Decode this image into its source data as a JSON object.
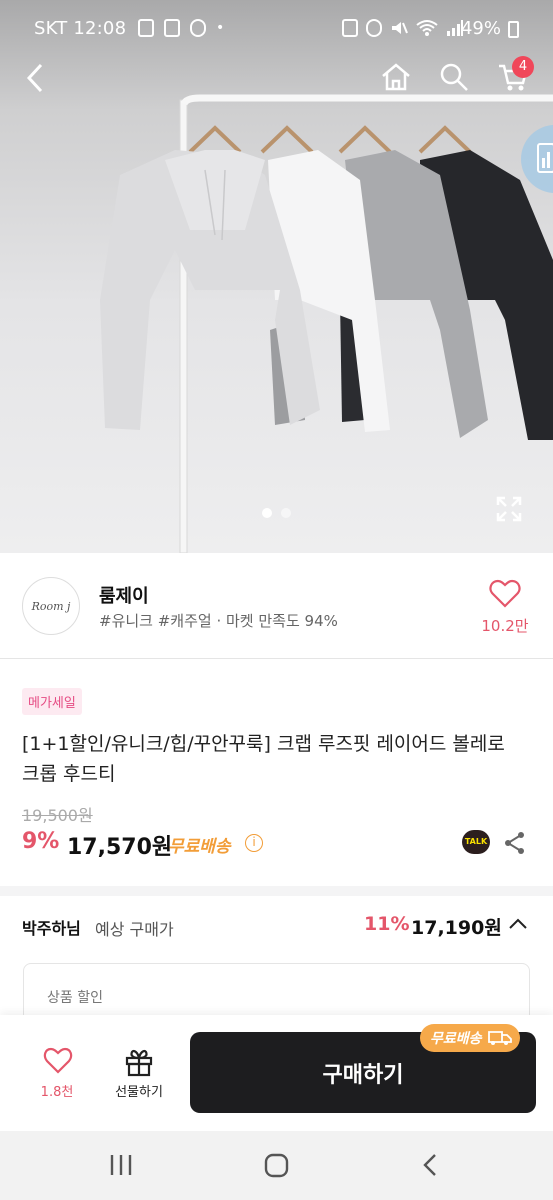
{
  "status_bar": {
    "carrier_time": "SKT 12:08",
    "battery": "49%",
    "dot": "•"
  },
  "top_bar": {
    "cart_count": "4"
  },
  "gallery": {
    "total_images": 2,
    "current_index": 1
  },
  "store": {
    "logo_text": "Room j",
    "name": "룸제이",
    "tags": "#유니크 #캐주얼 · 마켓 만족도 94%",
    "like_count": "10.2만"
  },
  "product": {
    "badge": "메가세일",
    "title": "[1+1할인/유니크/힙/꾸안꾸룩] 크랩 루즈핏 레이어드 볼레로 크롭 후드티",
    "original_price": "19,500원",
    "discount": "9%",
    "price": "17,570원",
    "free_shipping": "무료배송",
    "info_glyph": "i",
    "kakao_label": "TALK"
  },
  "expected_price": {
    "buyer": "박주하님",
    "label": "예상 구매가",
    "discount": "11%",
    "price": "17,190원"
  },
  "discount_box": {
    "label": "상품 할인"
  },
  "bottom_bar": {
    "like_count": "1.8천",
    "gift_label": "선물하기",
    "buy_label": "구매하기",
    "shipping_pill": "무료배송"
  },
  "colors": {
    "accent_pink": "#e4566a",
    "orange": "#f29d38",
    "buy_button": "#1d1d1f",
    "badge_pink": "#e64c84"
  }
}
